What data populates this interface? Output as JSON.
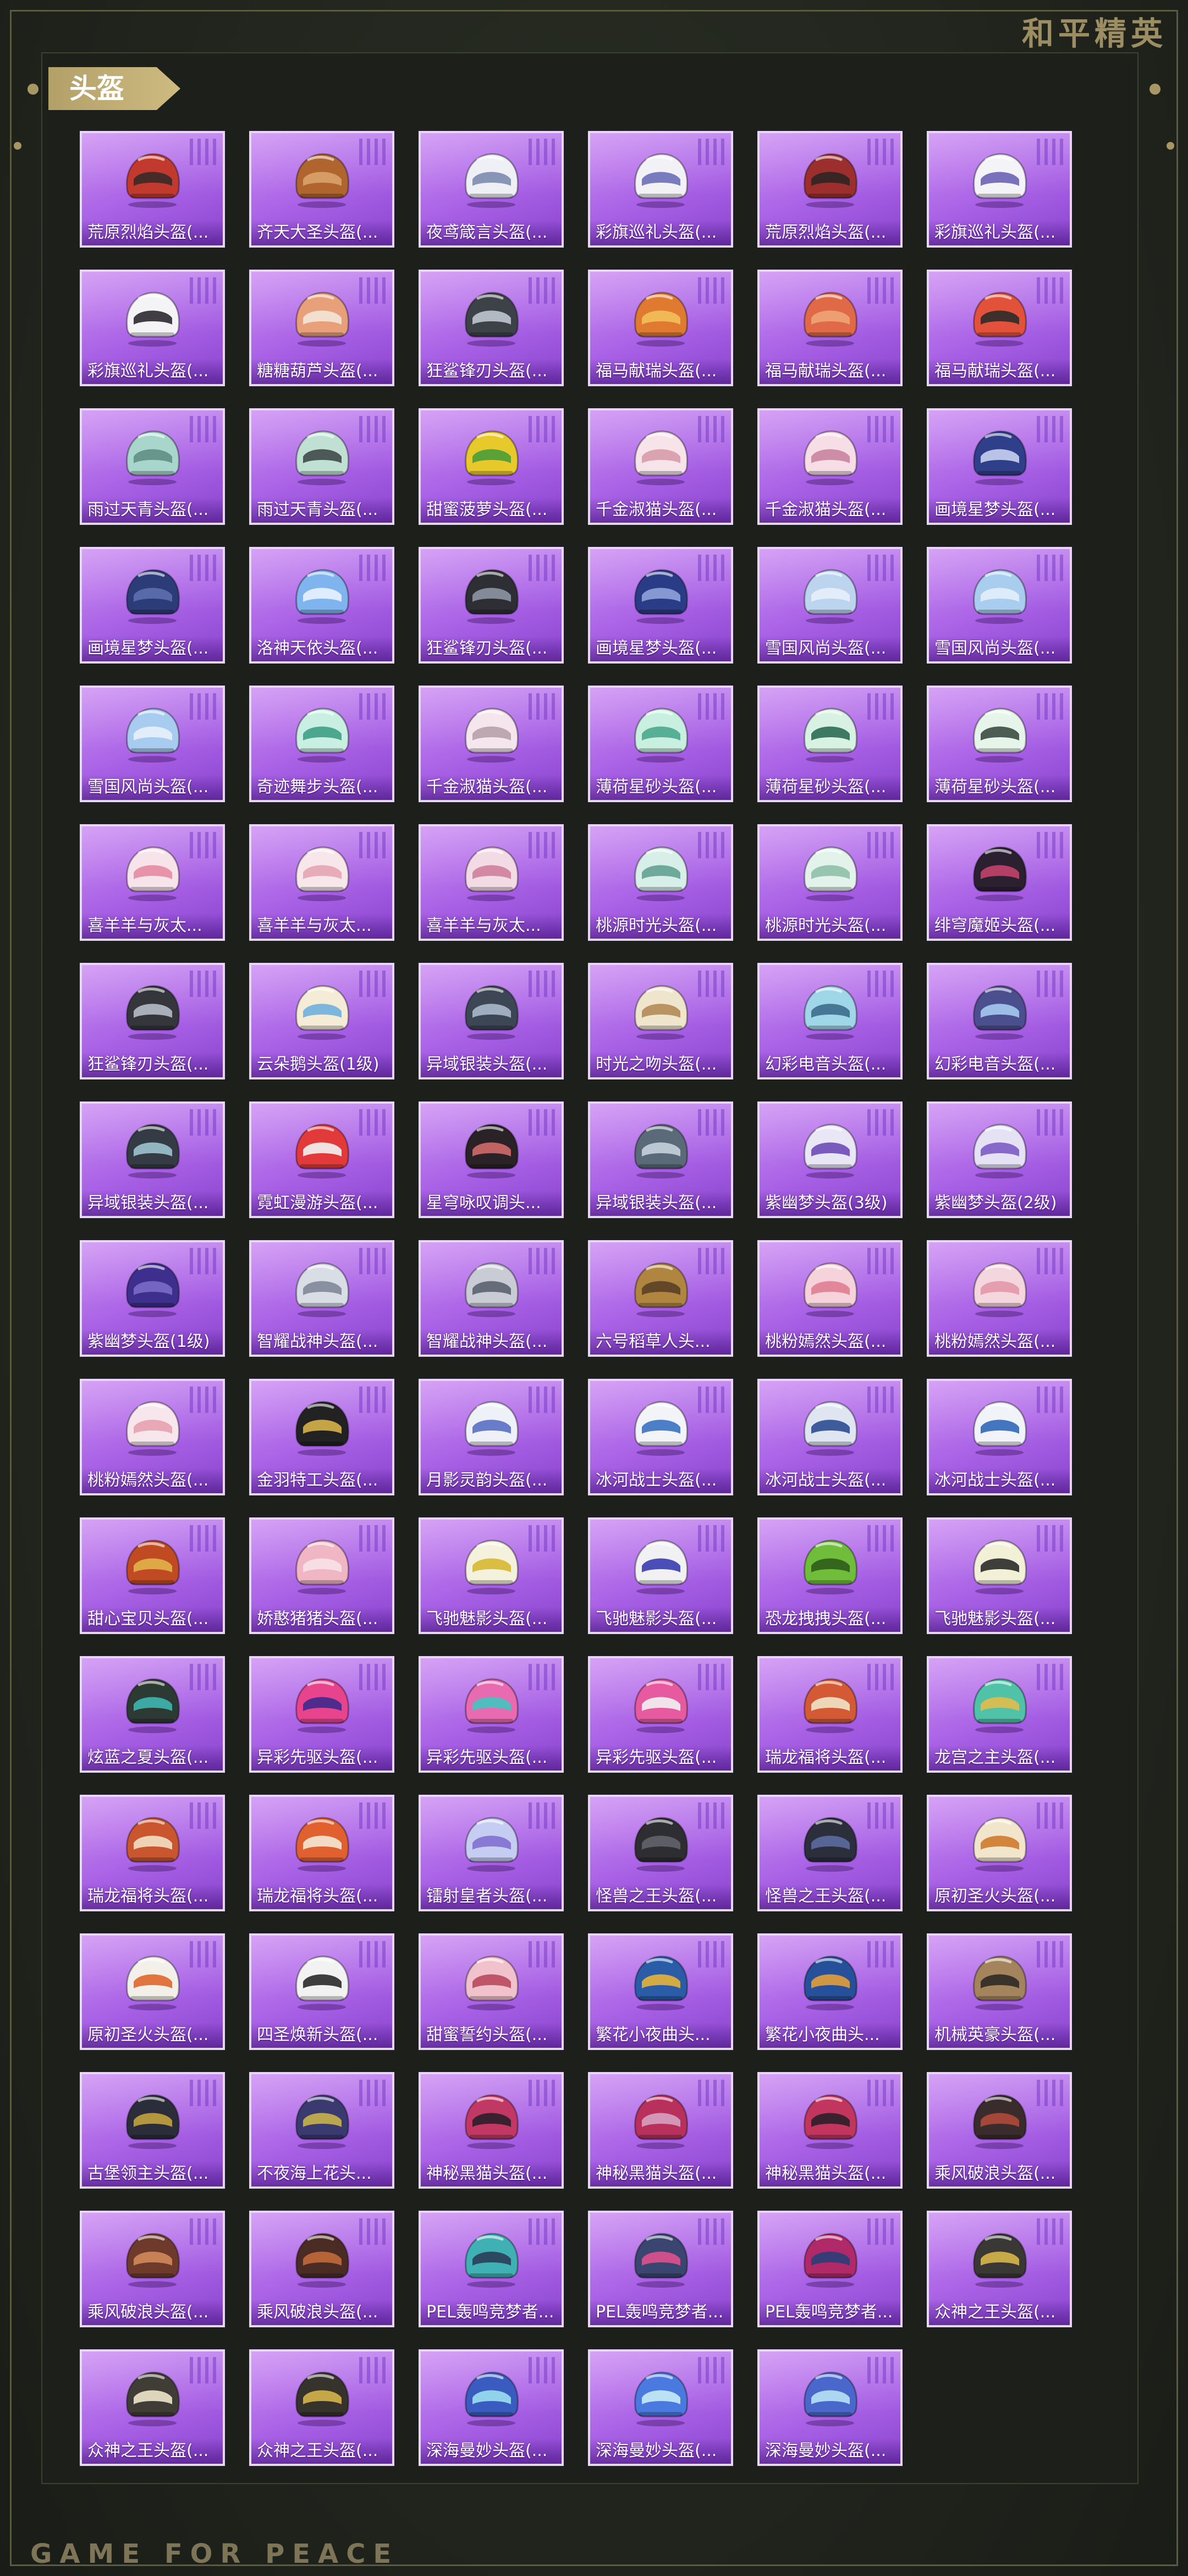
{
  "brand": {
    "title": "和平精英",
    "footer": "GAME FOR PEACE"
  },
  "section": {
    "title": "头盔"
  },
  "items": [
    {
      "label": "荒原烈焰头盔(...",
      "icon": "helmet-icon",
      "color": "#c23a2e",
      "accent": "#3a2a28"
    },
    {
      "label": "齐天大圣头盔(...",
      "icon": "helmet-icon",
      "color": "#b0652e",
      "accent": "#d9a36b"
    },
    {
      "label": "夜鸢箴言头盔(...",
      "icon": "helmet-icon",
      "color": "#eef0f6",
      "accent": "#7c8bb0"
    },
    {
      "label": "彩旗巡礼头盔(...",
      "icon": "helmet-icon",
      "color": "#f2f2f6",
      "accent": "#6a6fb8"
    },
    {
      "label": "荒原烈焰头盔(...",
      "icon": "helmet-icon",
      "color": "#9c2e2e",
      "accent": "#2d2523"
    },
    {
      "label": "彩旗巡礼头盔(...",
      "icon": "helmet-icon",
      "color": "#f4f4f8",
      "accent": "#6d63b6"
    },
    {
      "label": "彩旗巡礼头盔(...",
      "icon": "helmet-icon",
      "color": "#f4f4f6",
      "accent": "#2c2a30"
    },
    {
      "label": "糖糖葫芦头盔(...",
      "icon": "helmet-icon",
      "color": "#e8a07a",
      "accent": "#f3e6d8"
    },
    {
      "label": "狂鲨锋刃头盔(...",
      "icon": "helmet-icon",
      "color": "#3d4148",
      "accent": "#c0c6cf"
    },
    {
      "label": "福马献瑞头盔(...",
      "icon": "helmet-icon",
      "color": "#e07a30",
      "accent": "#f3c05a"
    },
    {
      "label": "福马献瑞头盔(...",
      "icon": "helmet-icon",
      "color": "#e06a48",
      "accent": "#f0a478"
    },
    {
      "label": "福马献瑞头盔(...",
      "icon": "helmet-icon",
      "color": "#e2513a",
      "accent": "#2b2b2b"
    },
    {
      "label": "雨过天青头盔(...",
      "icon": "helmet-icon",
      "color": "#a9d6cc",
      "accent": "#5f8f86"
    },
    {
      "label": "雨过天青头盔(...",
      "icon": "helmet-icon",
      "color": "#bfe0d3",
      "accent": "#3f4a48"
    },
    {
      "label": "甜蜜菠萝头盔(...",
      "icon": "helmet-icon",
      "color": "#e8c92c",
      "accent": "#4a9c3a"
    },
    {
      "label": "千金淑猫头盔(...",
      "icon": "helmet-icon",
      "color": "#f6e4ea",
      "accent": "#d89aa8"
    },
    {
      "label": "千金淑猫头盔(...",
      "icon": "helmet-icon",
      "color": "#f6dde6",
      "accent": "#c984a0"
    },
    {
      "label": "画境星梦头盔(...",
      "icon": "helmet-icon",
      "color": "#2f3f8a",
      "accent": "#c9d2ef"
    },
    {
      "label": "画境星梦头盔(...",
      "icon": "helmet-icon",
      "color": "#2c3c78",
      "accent": "#5d6fae"
    },
    {
      "label": "洛神天依头盔(...",
      "icon": "helmet-icon",
      "color": "#7fb4ef",
      "accent": "#e9f2ff"
    },
    {
      "label": "狂鲨锋刃头盔(...",
      "icon": "helmet-icon",
      "color": "#2d2f35",
      "accent": "#8e96a3"
    },
    {
      "label": "画境星梦头盔(...",
      "icon": "helmet-icon",
      "color": "#2a3c86",
      "accent": "#8fa2d9"
    },
    {
      "label": "雪国风尚头盔(...",
      "icon": "helmet-icon",
      "color": "#bcd4ee",
      "accent": "#e7f0fb"
    },
    {
      "label": "雪国风尚头盔(...",
      "icon": "helmet-icon",
      "color": "#a9cdee",
      "accent": "#e3eefa"
    },
    {
      "label": "雪国风尚头盔(...",
      "icon": "helmet-icon",
      "color": "#a8cbf0",
      "accent": "#e8f1fb"
    },
    {
      "label": "奇迹舞步头盔(...",
      "icon": "helmet-icon",
      "color": "#c9efe2",
      "accent": "#3e9f86"
    },
    {
      "label": "千金淑猫头盔(...",
      "icon": "helmet-icon",
      "color": "#f4e6ec",
      "accent": "#b7a0ab"
    },
    {
      "label": "薄荷星砂头盔(...",
      "icon": "helmet-icon",
      "color": "#c8efe0",
      "accent": "#4aa88e"
    },
    {
      "label": "薄荷星砂头盔(...",
      "icon": "helmet-icon",
      "color": "#d7f1e2",
      "accent": "#2e6c55"
    },
    {
      "label": "薄荷星砂头盔(...",
      "icon": "helmet-icon",
      "color": "#e6f4ea",
      "accent": "#3c4c44"
    },
    {
      "label": "喜羊羊与灰太...",
      "icon": "helmet-icon",
      "color": "#f7e3ea",
      "accent": "#e48aa2"
    },
    {
      "label": "喜羊羊与灰太...",
      "icon": "helmet-icon",
      "color": "#f7e6ea",
      "accent": "#e5a4b4"
    },
    {
      "label": "喜羊羊与灰太...",
      "icon": "helmet-icon",
      "color": "#f3dbe5",
      "accent": "#d07f9b"
    },
    {
      "label": "桃源时光头盔(...",
      "icon": "helmet-icon",
      "color": "#d7efe8",
      "accent": "#64a192"
    },
    {
      "label": "桃源时光头盔(...",
      "icon": "helmet-icon",
      "color": "#e3f2ea",
      "accent": "#8fc0a8"
    },
    {
      "label": "绯穹魔姬头盔(...",
      "icon": "helmet-icon",
      "color": "#2b2030",
      "accent": "#c2446a"
    },
    {
      "label": "狂鲨锋刃头盔(...",
      "icon": "helmet-icon",
      "color": "#34363c",
      "accent": "#b6bcc6"
    },
    {
      "label": "云朵鹅头盔(1级)",
      "icon": "helmet-icon",
      "color": "#f5ecd7",
      "accent": "#6fb0de"
    },
    {
      "label": "异域银装头盔(...",
      "icon": "helmet-icon",
      "color": "#3c4654",
      "accent": "#a8b8cc"
    },
    {
      "label": "时光之吻头盔(...",
      "icon": "helmet-icon",
      "color": "#efe4cc",
      "accent": "#b38a55"
    },
    {
      "label": "幻彩电音头盔(...",
      "icon": "helmet-icon",
      "color": "#9fd6e8",
      "accent": "#3c6e8c"
    },
    {
      "label": "幻彩电音头盔(...",
      "icon": "helmet-icon",
      "color": "#4c4f8e",
      "accent": "#a4c9ef"
    },
    {
      "label": "异域银装头盔(...",
      "icon": "helmet-icon",
      "color": "#353b44",
      "accent": "#9cc3cf"
    },
    {
      "label": "霓虹漫游头盔(...",
      "icon": "helmet-icon",
      "color": "#e23a3a",
      "accent": "#f4f4f4"
    },
    {
      "label": "星穹咏叹调头...",
      "icon": "helmet-icon",
      "color": "#2a2226",
      "accent": "#d16a6a"
    },
    {
      "label": "异域银装头盔(...",
      "icon": "helmet-icon",
      "color": "#5a6a78",
      "accent": "#c5d3de"
    },
    {
      "label": "紫幽梦头盔(3级)",
      "icon": "helmet-icon",
      "color": "#e9e6f6",
      "accent": "#6d4bb8"
    },
    {
      "label": "紫幽梦头盔(2级)",
      "icon": "helmet-icon",
      "color": "#e6e2f6",
      "accent": "#7c5cc8"
    },
    {
      "label": "紫幽梦头盔(1级)",
      "icon": "helmet-icon",
      "color": "#3e2f8e",
      "accent": "#7a6cc8"
    },
    {
      "label": "智耀战神头盔(...",
      "icon": "helmet-icon",
      "color": "#d9dde6",
      "accent": "#7f8797"
    },
    {
      "label": "智耀战神头盔(...",
      "icon": "helmet-icon",
      "color": "#c9ccd4",
      "accent": "#5c6270"
    },
    {
      "label": "六号稻草人头...",
      "icon": "helmet-icon",
      "color": "#b08540",
      "accent": "#5a4026"
    },
    {
      "label": "桃粉嫣然头盔(...",
      "icon": "helmet-icon",
      "color": "#f6d2da",
      "accent": "#e07e92"
    },
    {
      "label": "桃粉嫣然头盔(...",
      "icon": "helmet-icon",
      "color": "#f4d6de",
      "accent": "#e497a8"
    },
    {
      "label": "桃粉嫣然头盔(...",
      "icon": "helmet-icon",
      "color": "#f7e7ec",
      "accent": "#e6a1b0"
    },
    {
      "label": "金羽特工头盔(...",
      "icon": "helmet-icon",
      "color": "#222222",
      "accent": "#d7b24a"
    },
    {
      "label": "月影灵韵头盔(...",
      "icon": "helmet-icon",
      "color": "#eef1f8",
      "accent": "#5a6fc4"
    },
    {
      "label": "冰河战士头盔(...",
      "icon": "helmet-icon",
      "color": "#f2f4f8",
      "accent": "#3a72c2"
    },
    {
      "label": "冰河战士头盔(...",
      "icon": "helmet-icon",
      "color": "#dfe6f2",
      "accent": "#2a4d92"
    },
    {
      "label": "冰河战士头盔(...",
      "icon": "helmet-icon",
      "color": "#f0f3f8",
      "accent": "#3068b8"
    },
    {
      "label": "甜心宝贝头盔(...",
      "icon": "helmet-icon",
      "color": "#c04a22",
      "accent": "#e2b24a"
    },
    {
      "label": "娇憨猪猪头盔(...",
      "icon": "helmet-icon",
      "color": "#f1b6c4",
      "accent": "#f7e2e8"
    },
    {
      "label": "飞驰魅影头盔(...",
      "icon": "helmet-icon",
      "color": "#f4f1dc",
      "accent": "#d6b830"
    },
    {
      "label": "飞驰魅影头盔(...",
      "icon": "helmet-icon",
      "color": "#f1f1f4",
      "accent": "#3a3cb0"
    },
    {
      "label": "恐龙拽拽头盔(...",
      "icon": "helmet-icon",
      "color": "#6fbd3a",
      "accent": "#2e5c1c"
    },
    {
      "label": "飞驰魅影头盔(...",
      "icon": "helmet-icon",
      "color": "#f3f0d8",
      "accent": "#2a2a2a"
    },
    {
      "label": "炫蓝之夏头盔(...",
      "icon": "helmet-icon",
      "color": "#2d3a34",
      "accent": "#3fb6b0"
    },
    {
      "label": "异彩先驱头盔(...",
      "icon": "helmet-icon",
      "color": "#e8448e",
      "accent": "#3d2a8e"
    },
    {
      "label": "异彩先驱头盔(...",
      "icon": "helmet-icon",
      "color": "#e86ab0",
      "accent": "#40c6c0"
    },
    {
      "label": "异彩先驱头盔(...",
      "icon": "helmet-icon",
      "color": "#e85aa0",
      "accent": "#f2f2f2"
    },
    {
      "label": "瑞龙福将头盔(...",
      "icon": "helmet-icon",
      "color": "#d45a36",
      "accent": "#f1e4c8"
    },
    {
      "label": "龙宫之主头盔(...",
      "icon": "helmet-icon",
      "color": "#4fc2a8",
      "accent": "#e2bc4a"
    },
    {
      "label": "瑞龙福将头盔(...",
      "icon": "helmet-icon",
      "color": "#c9562e",
      "accent": "#f1e0c4"
    },
    {
      "label": "瑞龙福将头盔(...",
      "icon": "helmet-icon",
      "color": "#e06030",
      "accent": "#f4e8d6"
    },
    {
      "label": "镭射皇者头盔(...",
      "icon": "helmet-icon",
      "color": "#c6cdf2",
      "accent": "#8070d0"
    },
    {
      "label": "怪兽之王头盔(...",
      "icon": "helmet-icon",
      "color": "#2e2e32",
      "accent": "#63636b"
    },
    {
      "label": "怪兽之王头盔(...",
      "icon": "helmet-icon",
      "color": "#2b2f3c",
      "accent": "#5c6aa0"
    },
    {
      "label": "原初圣火头盔(...",
      "icon": "helmet-icon",
      "color": "#f1e6cc",
      "accent": "#d07a2e"
    },
    {
      "label": "原初圣火头盔(...",
      "icon": "helmet-icon",
      "color": "#f3f0ea",
      "accent": "#e0662c"
    },
    {
      "label": "四圣焕新头盔(...",
      "icon": "helmet-icon",
      "color": "#f2f2f2",
      "accent": "#2a2a2a"
    },
    {
      "label": "甜蜜誓约头盔(...",
      "icon": "helmet-icon",
      "color": "#f2c2cc",
      "accent": "#b8495e"
    },
    {
      "label": "繁花小夜曲头...",
      "icon": "helmet-icon",
      "color": "#2a5ca8",
      "accent": "#e6b43a"
    },
    {
      "label": "繁花小夜曲头...",
      "icon": "helmet-icon",
      "color": "#27509a",
      "accent": "#e29f3a"
    },
    {
      "label": "机械英豪头盔(...",
      "icon": "helmet-icon",
      "color": "#a4845c",
      "accent": "#2d2a26"
    },
    {
      "label": "古堡领主头盔(...",
      "icon": "helmet-icon",
      "color": "#2b2e3a",
      "accent": "#c2a23e"
    },
    {
      "label": "不夜海上花头...",
      "icon": "helmet-icon",
      "color": "#3a3a70",
      "accent": "#c8b24a"
    },
    {
      "label": "神秘黑猫头盔(...",
      "icon": "helmet-icon",
      "color": "#c23864",
      "accent": "#2a1f2a"
    },
    {
      "label": "神秘黑猫头盔(...",
      "icon": "helmet-icon",
      "color": "#b8305c",
      "accent": "#d7a2c0"
    },
    {
      "label": "神秘黑猫头盔(...",
      "icon": "helmet-icon",
      "color": "#c2355e",
      "accent": "#2a2028"
    },
    {
      "label": "乘风破浪头盔(...",
      "icon": "helmet-icon",
      "color": "#3a2c2c",
      "accent": "#b04a3a"
    },
    {
      "label": "乘风破浪头盔(...",
      "icon": "helmet-icon",
      "color": "#6e3a2c",
      "accent": "#d08a5a"
    },
    {
      "label": "乘风破浪头盔(...",
      "icon": "helmet-icon",
      "color": "#4a2c24",
      "accent": "#c26a3a"
    },
    {
      "label": "PEL轰鸣竞梦者...",
      "icon": "helmet-icon",
      "color": "#3fb0b4",
      "accent": "#2a3e58"
    },
    {
      "label": "PEL轰鸣竞梦者...",
      "icon": "helmet-icon",
      "color": "#3a4670",
      "accent": "#e0508e"
    },
    {
      "label": "PEL轰鸣竞梦者...",
      "icon": "helmet-icon",
      "color": "#b02a6a",
      "accent": "#2a3e78"
    },
    {
      "label": "众神之王头盔(...",
      "icon": "helmet-icon",
      "color": "#3a3834",
      "accent": "#d8b64a"
    },
    {
      "label": "众神之王头盔(...",
      "icon": "helmet-icon",
      "color": "#403c36",
      "accent": "#efe6cc"
    },
    {
      "label": "众神之王头盔(...",
      "icon": "helmet-icon",
      "color": "#36322c",
      "accent": "#d6b44a"
    },
    {
      "label": "深海曼妙头盔(...",
      "icon": "helmet-icon",
      "color": "#3a5cc0",
      "accent": "#9ae0f0"
    },
    {
      "label": "深海曼妙头盔(...",
      "icon": "helmet-icon",
      "color": "#4a7ae0",
      "accent": "#c6ecf6"
    },
    {
      "label": "深海曼妙头盔(...",
      "icon": "helmet-icon",
      "color": "#4a68cc",
      "accent": "#b8e2f4"
    }
  ]
}
